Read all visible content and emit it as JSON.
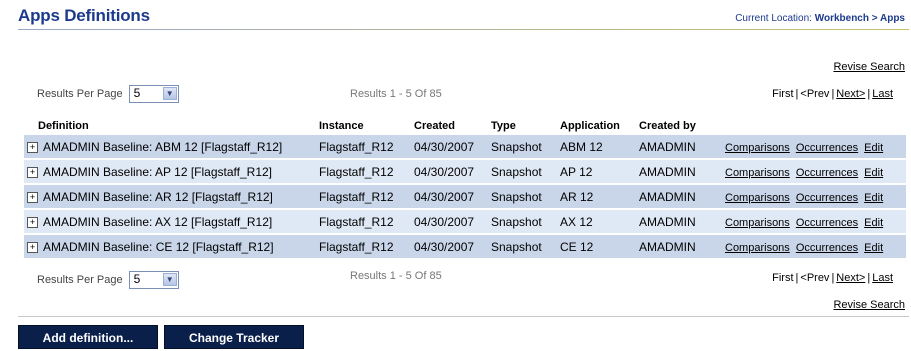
{
  "page": {
    "title": "Apps Definitions",
    "location_label": "Current Location:",
    "location_path": "Workbench > Apps"
  },
  "revise_search": "Revise Search",
  "results_per_page": {
    "label": "Results Per Page",
    "value": "5"
  },
  "results_text": "Results 1 - 5 Of 85",
  "pager": {
    "first": "First",
    "prev": "<Prev",
    "next": "Next>",
    "last": "Last"
  },
  "table": {
    "columns": [
      "Definition",
      "Instance",
      "Created",
      "Type",
      "Application",
      "Created by"
    ],
    "rows": [
      {
        "expand": "+",
        "definition": "AMADMIN Baseline: ABM 12 [Flagstaff_R12]",
        "instance": "Flagstaff_R12",
        "created": "04/30/2007",
        "type": "Snapshot",
        "application": "ABM 12",
        "created_by": "AMADMIN"
      },
      {
        "expand": "+",
        "definition": "AMADMIN Baseline: AP 12 [Flagstaff_R12]",
        "instance": "Flagstaff_R12",
        "created": "04/30/2007",
        "type": "Snapshot",
        "application": "AP 12",
        "created_by": "AMADMIN"
      },
      {
        "expand": "+",
        "definition": "AMADMIN Baseline: AR 12 [Flagstaff_R12]",
        "instance": "Flagstaff_R12",
        "created": "04/30/2007",
        "type": "Snapshot",
        "application": "AR 12",
        "created_by": "AMADMIN"
      },
      {
        "expand": "+",
        "definition": "AMADMIN Baseline: AX 12 [Flagstaff_R12]",
        "instance": "Flagstaff_R12",
        "created": "04/30/2007",
        "type": "Snapshot",
        "application": "AX 12",
        "created_by": "AMADMIN"
      },
      {
        "expand": "+",
        "definition": "AMADMIN Baseline: CE 12 [Flagstaff_R12]",
        "instance": "Flagstaff_R12",
        "created": "04/30/2007",
        "type": "Snapshot",
        "application": "CE 12",
        "created_by": "AMADMIN"
      }
    ],
    "actions": {
      "comparisons": "Comparisons",
      "occurrences": "Occurrences",
      "edit": "Edit"
    }
  },
  "buttons": {
    "add_definition": "Add definition...",
    "change_tracker": "Change Tracker"
  },
  "icons": {
    "expand": "plus-box-icon",
    "dropdown": "chevron-down-icon"
  },
  "colors": {
    "title": "#1c3a8c",
    "row_odd": "#c9d6ea",
    "row_even": "#dfe8f5",
    "button_bg": "#0a1f4a"
  }
}
